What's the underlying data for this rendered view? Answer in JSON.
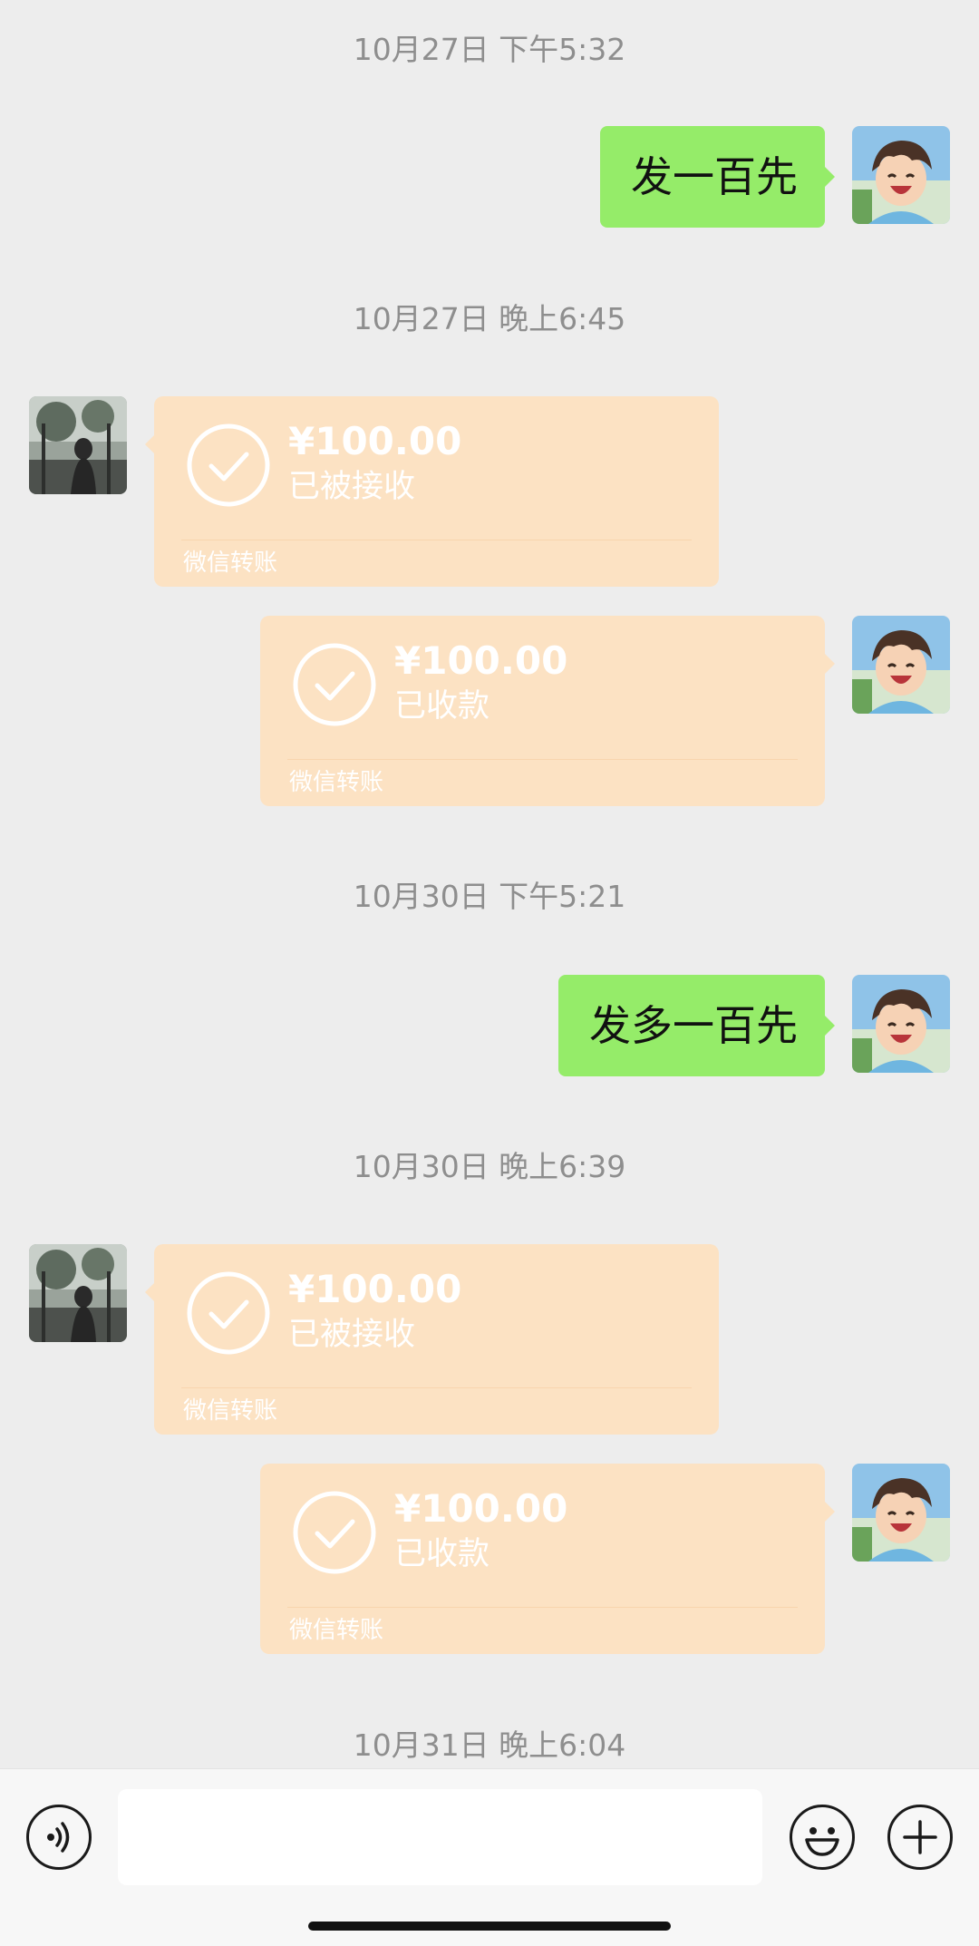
{
  "timestamps": [
    "10月27日 下午5:32",
    "10月27日 晚上6:45",
    "10月30日 下午5:21",
    "10月30日 晚上6:39",
    "10月31日 晚上6:04"
  ],
  "messages": {
    "m1_text": "发一百先",
    "m6_text": "发多一百先"
  },
  "transfers": [
    {
      "amount": "¥100.00",
      "status": "已被接收",
      "label": "微信转账"
    },
    {
      "amount": "¥100.00",
      "status": "已收款",
      "label": "微信转账"
    },
    {
      "amount": "¥100.00",
      "status": "已被接收",
      "label": "微信转账"
    },
    {
      "amount": "¥100.00",
      "status": "已收款",
      "label": "微信转账"
    }
  ],
  "input": {
    "value": "",
    "placeholder": ""
  },
  "icons": {
    "voice": "voice-icon",
    "emoji": "emoji-icon",
    "plus": "plus-icon"
  },
  "colors": {
    "background": "#ededed",
    "sent_bubble": "#95ec69",
    "transfer_bubble": "#fce2c3",
    "timestamp_text": "#8e8e8e"
  }
}
